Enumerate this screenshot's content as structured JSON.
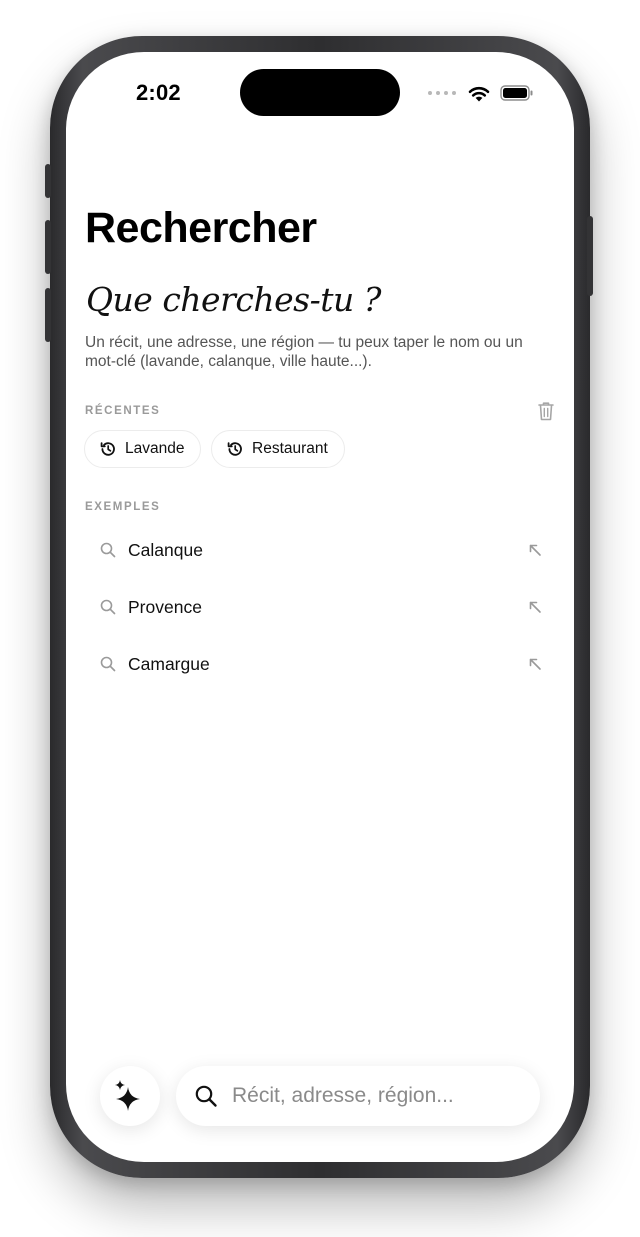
{
  "status_bar": {
    "time": "2:02"
  },
  "page": {
    "title": "Rechercher",
    "prompt_title": "Que cherches-tu ?",
    "description": "Un récit, une adresse, une région — tu peux taper le nom ou un mot-clé (lavande, calanque, ville haute...)."
  },
  "recent": {
    "label": "RÉCENTES",
    "items": [
      "Lavande",
      "Restaurant"
    ]
  },
  "examples": {
    "label": "EXEMPLES",
    "items": [
      "Calanque",
      "Provence",
      "Camargue"
    ]
  },
  "search": {
    "placeholder": "Récit, adresse, région..."
  },
  "icons": {
    "status": [
      "cellular-dots-icon",
      "wifi-icon",
      "battery-icon"
    ],
    "recent_clear": "trash-icon",
    "recent_item": "history-icon",
    "example_item": "search-icon",
    "example_fill": "arrow-up-left-icon",
    "assistant": "sparkles-icon",
    "search_bar": "search-icon"
  },
  "colors": {
    "text": "#111111",
    "muted": "#9a9a9a",
    "frame": "#2e2e30"
  }
}
